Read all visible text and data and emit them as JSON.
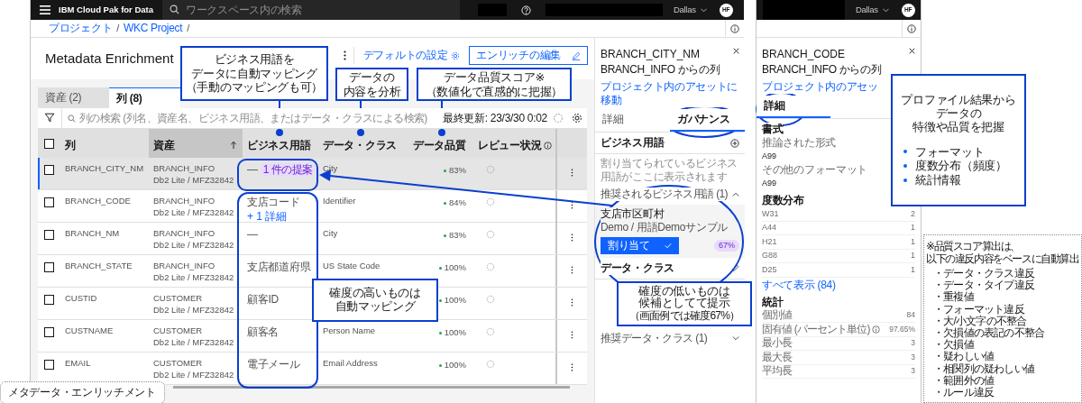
{
  "main_screen": {
    "header": {
      "product": "IBM Cloud Pak for Data",
      "search_placeholder": "ワークスペース内の検索",
      "region": "Dallas",
      "avatar": "HF"
    },
    "breadcrumb": {
      "items": [
        "プロジェクト",
        "WKC Project"
      ],
      "separator": "/"
    },
    "title": "Metadata Enrichment",
    "actions": [
      {
        "kind": "link",
        "label": "デフォルトの設定"
      },
      {
        "kind": "outline",
        "label": "エンリッチの編集"
      }
    ],
    "tabs": [
      {
        "label": "資産 (2)",
        "selected": false
      },
      {
        "label": "列 (8)",
        "selected": true
      }
    ],
    "search_placeholder": "列の検索 (列名、資産名、ビジネス用語、またはデータ・クラスによる検索)",
    "last_updated": "最終更新: 23/3/30 0:02",
    "table": {
      "all_checked": false,
      "columns": [
        {
          "label": "列",
          "sorted": false,
          "info": false
        },
        {
          "label": "資産",
          "sorted": true,
          "info": false
        },
        {
          "label": "ビジネス用語",
          "sorted": false,
          "info": false
        },
        {
          "label": "データ・クラス",
          "sorted": false,
          "info": false
        },
        {
          "label": "データ品質",
          "sorted": false,
          "info": false
        },
        {
          "label": "レビュー状況",
          "sorted": false,
          "info": true
        }
      ],
      "rows": [
        {
          "column": "BRANCH_CITY_NM",
          "asset": "BRANCH_INFO",
          "source": "Db2 Lite / MFZ32842",
          "term": "—",
          "suggestion": "1 件の提案",
          "data_class": "City",
          "quality": "83%",
          "selected": true,
          "checked": false
        },
        {
          "column": "BRANCH_CODE",
          "asset": "BRANCH_INFO",
          "source": "Db2 Lite / MFZ32842",
          "term": "支店コード",
          "term_link": "+ 1 詳細",
          "data_class": "Identifier",
          "quality": "84%",
          "selected": false,
          "checked": false
        },
        {
          "column": "BRANCH_NM",
          "asset": "BRANCH_INFO",
          "source": "Db2 Lite / MFZ32842",
          "term": "—",
          "data_class": "City",
          "quality": "83%",
          "selected": false,
          "checked": false
        },
        {
          "column": "BRANCH_STATE",
          "asset": "BRANCH_INFO",
          "source": "Db2 Lite / MFZ32842",
          "term": "支店都道府県",
          "data_class": "US State Code",
          "quality": "100%",
          "selected": false,
          "checked": false
        },
        {
          "column": "CUSTID",
          "asset": "CUSTOMER",
          "source": "Db2 Lite / MFZ32842",
          "term": "顧客ID",
          "quality": "100%",
          "selected": false,
          "checked": false
        },
        {
          "column": "CUSTNAME",
          "asset": "CUSTOMER",
          "source": "Db2 Lite / MFZ32842",
          "term": "顧客名",
          "data_class": "Person Name",
          "quality": "100%",
          "selected": false,
          "checked": false
        },
        {
          "column": "EMAIL",
          "asset": "CUSTOMER",
          "source": "Db2 Lite / MFZ32842",
          "term": "電子メール",
          "data_class": "Email Address",
          "quality": "100%",
          "selected": false,
          "checked": false
        }
      ]
    }
  },
  "details_panel": {
    "title": "BRANCH_CITY_NM",
    "subtitle": "BRANCH_INFO からの列",
    "link": "プロジェクト内のアセットに移動",
    "tabs": [
      {
        "label": "詳細",
        "selected": false
      },
      {
        "label": "ガバナンス",
        "selected": true
      }
    ],
    "terms_title": "ビジネス用語",
    "empty_text": "割り当てられているビジネス用語がここに表示されます",
    "suggested_terms": {
      "label": "推奨されるビジネス用語 (1)",
      "expanded": true
    },
    "suggestion": {
      "term": "支店市区町村",
      "source": "Demo / 用語Demoサンプル",
      "button": "割り当て",
      "confidence": "67%"
    },
    "class_title": "データ・クラス",
    "suggested_classes": {
      "label": "推奨データ・クラス (1)",
      "expanded": false
    }
  },
  "profile_screen": {
    "region": "Dallas",
    "avatar": "HF",
    "title": "BRANCH_CODE",
    "subtitle": "BRANCH_INFO からの列",
    "link": "プロジェクト内のアセッ",
    "tabs": [
      {
        "label": "詳細",
        "selected": true
      }
    ],
    "format": {
      "title": "書式",
      "fields": [
        {
          "label": "推論された形式",
          "value": "A99"
        },
        {
          "label": "その他のフォーマット",
          "value": "A99"
        }
      ]
    },
    "frequency": {
      "title": "度数分布",
      "rows": [
        {
          "label": "W31",
          "value": "2"
        },
        {
          "label": "A44",
          "value": "1"
        },
        {
          "label": "H21",
          "value": "1"
        },
        {
          "label": "G88",
          "value": "1"
        },
        {
          "label": "D25",
          "value": "1"
        }
      ],
      "link": "すべて表示 (84)"
    },
    "stats": {
      "title": "統計",
      "rows": [
        {
          "label": "個別値",
          "value": "84",
          "info": false
        },
        {
          "label": "固有値 (パーセント単位)",
          "value": "97.65%",
          "info": true
        },
        {
          "label": "最小長",
          "value": "3",
          "info": false
        },
        {
          "label": "最大長",
          "value": "3",
          "info": false
        },
        {
          "label": "平均長",
          "value": "3",
          "info": false
        }
      ]
    }
  },
  "callouts": [
    {
      "lines": [
        "ビジネス用語を",
        "データに自動マッピング",
        "（手動のマッピングも可）"
      ]
    },
    {
      "lines": [
        "データの",
        "内容を分析"
      ]
    },
    {
      "lines": [
        "データ品質スコア※",
        "（数値化で直感的に把握）"
      ]
    },
    {
      "lines": [
        "確度の高いものは",
        "自動マッピング"
      ]
    },
    {
      "lines": [
        "確度の低いものは",
        "候補としてて提示"
      ],
      "note": "（画面例では確度67%）"
    },
    {
      "lines": [
        "プロファイル結果から",
        "データの",
        "特徴や品質を把握"
      ],
      "points": [
        "フォーマット",
        "度数分布（頻度）",
        "統計情報"
      ]
    }
  ],
  "quality_note": {
    "lines": [
      "※品質スコア算出は、",
      "以下の違反内容をベースに自動算出"
    ],
    "items": [
      "・データ・クラス違反",
      "・データ・タイプ違反",
      "・重複値",
      "・フォーマット違反",
      "・大/小文字の不整合",
      "・欠損値の表記の不整合",
      "・欠損値",
      "・疑わしい値",
      "・相関列の疑わしい値",
      "・範囲外の値",
      "・ルール違反"
    ]
  },
  "caption": "メタデータ・エンリッチメント"
}
